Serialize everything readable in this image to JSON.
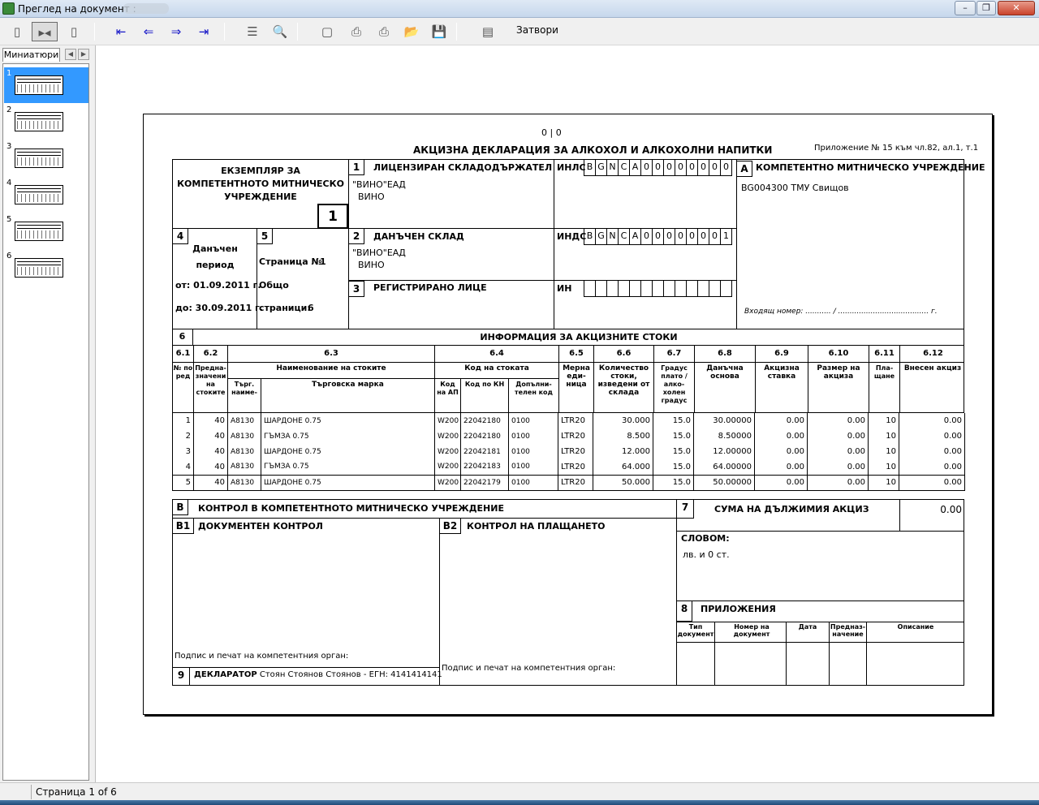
{
  "window": {
    "title": "Преглед на документ :"
  },
  "toolbar": {
    "close_label": "Затвори"
  },
  "sidebar": {
    "tab_label": "Миниатюри",
    "pages": [
      "1",
      "2",
      "3",
      "4",
      "5",
      "6"
    ]
  },
  "status": {
    "page_text": "Страница 1 of 6"
  },
  "doc": {
    "counter": "0 | 0",
    "main_title": "АКЦИЗНА ДЕКЛАРАЦИЯ ЗА АЛКОХОЛ И АЛКОХОЛНИ НАПИТКИ",
    "annex": "Приложение № 15 към чл.82, ал.1, т.1",
    "copy_line1": "ЕКЗЕМПЛЯР ЗА",
    "copy_line2": "КОМПЕТЕНТНОТО МИТНИЧЕСКО",
    "copy_line3": "УЧРЕЖДЕНИЕ",
    "copy_number": "1",
    "b1_num": "1",
    "b1_title": "ЛИЦЕНЗИРАН СКЛАДОДЪРЖАТЕЛ",
    "b1_name1": "\"ВИНО\"ЕАД",
    "b1_name2": "ВИНО",
    "inls_label": "ИНЛС",
    "inls_chars": [
      "B",
      "G",
      "N",
      "C",
      "A",
      "0",
      "0",
      "0",
      "0",
      "0",
      "0",
      "0",
      "0"
    ],
    "bA_num": "A",
    "bA_title": "КОМПЕТЕНТНО МИТНИЧЕСКО УЧРЕЖДЕНИЕ",
    "bA_value": "BG004300 ТМУ Свищов",
    "incoming": "Входящ номер: ........... / ....................................... г.",
    "b4_num": "4",
    "b4_label1": "Данъчен",
    "b4_label2": "период",
    "b4_from": "от: 01.09.2011 г.",
    "b4_to": "до: 30.09.2011 г.",
    "b5_num": "5",
    "b5_page": "Страница №",
    "b5_page_val": "1",
    "b5_total": "Общо",
    "b5_pages": "страници:",
    "b5_pages_val": "6",
    "b2_num": "2",
    "b2_title": "ДАНЪЧЕН СКЛАД",
    "b2_name1": "\"ВИНО\"ЕАД",
    "b2_name2": "ВИНО",
    "inds_label": "ИНДС",
    "inds_chars": [
      "B",
      "G",
      "N",
      "C",
      "A",
      "0",
      "0",
      "0",
      "0",
      "0",
      "0",
      "0",
      "1"
    ],
    "b3_num": "3",
    "b3_title": "РЕГИСТРИРАНО ЛИЦЕ",
    "in_label": "ИН",
    "b6_num": "6",
    "b6_title": "ИНФОРМАЦИЯ ЗА АКЦИЗНИТЕ СТОКИ",
    "col_nums": [
      "6.1",
      "6.2",
      "6.3",
      "6.4",
      "6.5",
      "6.6",
      "6.7",
      "6.8",
      "6.9",
      "6.10",
      "6.11",
      "6.12"
    ],
    "h_no": "№ по ред",
    "h_purpose": "Предна-значени на стоките",
    "h_goods": "Наименование на стоките",
    "h_trade_name": "Търг. наиме-",
    "h_brand": "Търговска марка",
    "h_code": "Код на стоката",
    "h_code_ap": "Код на АП",
    "h_code_kn": "Код по КН",
    "h_code_add": "Допълни-телен код",
    "h_unit": "Мерна еди-ница",
    "h_qty": "Количество стоки, изведени от склада",
    "h_degree": "Градус плато / алко-холен градус",
    "h_base": "Данъчна основа",
    "h_rate": "Акцизна ставка",
    "h_amount": "Размер на акциза",
    "h_payment": "Пла-щане",
    "h_paid": "Внесен акциз",
    "rows": [
      [
        "1",
        "40",
        "A8130",
        "ШАРДОНЕ  0.75",
        "W200",
        "22042180",
        "0100",
        "LTR20",
        "30.000",
        "15.0",
        "30.00000",
        "0.00",
        "0.00",
        "10",
        "0.00"
      ],
      [
        "2",
        "40",
        "A8130",
        "ГЪМЗА  0.75",
        "W200",
        "22042180",
        "0100",
        "LTR20",
        "8.500",
        "15.0",
        "8.50000",
        "0.00",
        "0.00",
        "10",
        "0.00"
      ],
      [
        "3",
        "40",
        "A8130",
        "ШАРДОНЕ  0.75",
        "W200",
        "22042181",
        "0100",
        "LTR20",
        "12.000",
        "15.0",
        "12.00000",
        "0.00",
        "0.00",
        "10",
        "0.00"
      ],
      [
        "4",
        "40",
        "A8130",
        "ГЪМЗА  0.75",
        "W200",
        "22042183",
        "0100",
        "LTR20",
        "64.000",
        "15.0",
        "64.00000",
        "0.00",
        "0.00",
        "10",
        "0.00"
      ],
      [
        "5",
        "40",
        "A8130",
        "ШАРДОНЕ  0.75",
        "W200",
        "22042179",
        "0100",
        "LTR20",
        "50.000",
        "15.0",
        "50.00000",
        "0.00",
        "0.00",
        "10",
        "0.00"
      ]
    ],
    "bB_num": "B",
    "bB_title": "КОНТРОЛ В КОМПЕТЕНТНОТО МИТНИЧЕСКО УЧРЕЖДЕНИЕ",
    "bB1_num": "B1",
    "bB1_title": "ДОКУМЕНТЕН КОНТРОЛ",
    "bB2_num": "B2",
    "bB2_title": "КОНТРОЛ НА ПЛАЩАНЕТО",
    "sign_label": "Подпис и печат на компетентния орган:",
    "b7_num": "7",
    "b7_title": "СУМА НА ДЪЛЖИМИЯ АКЦИЗ",
    "b7_value": "0.00",
    "words_label": "СЛОВОМ:",
    "words_value": "лв. и 0 ст.",
    "b8_num": "8",
    "b8_title": "ПРИЛОЖЕНИЯ",
    "att_type": "Тип документ",
    "att_number": "Номер на документ",
    "att_date": "Дата",
    "att_purpose": "Предназ-начение",
    "att_desc": "Описание",
    "b9_num": "9",
    "b9_label": "ДЕКЛАРАТОР",
    "b9_value": "Стоян Стоянов Стоянов  -  ЕГН: 4141414141"
  }
}
